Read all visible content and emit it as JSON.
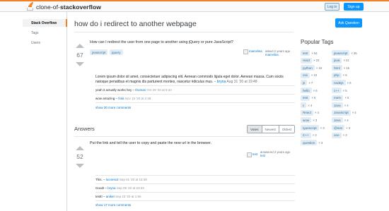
{
  "header": {
    "logo_prefix": "clone-of-",
    "logo_bold": "stackoverflow",
    "login_label": "Log in",
    "signup_label": "Sign up"
  },
  "sidebar": {
    "items": [
      {
        "label": "Stack Overflow",
        "active": true
      },
      {
        "label": "Tags",
        "active": false
      },
      {
        "label": "Users",
        "active": false
      }
    ]
  },
  "question": {
    "title": "how do i redirect to another webpage",
    "ask_label": "Ask Question",
    "votes": "67",
    "body": "How can I redirect the user from one page to another using jQuery or pure JavaScript?",
    "tags": [
      "javascript",
      "jquery"
    ],
    "avatar_alt": "marcelina",
    "asked": "asked 2 years ago",
    "author": "marcelina",
    "answer_text_line1": "Lorem ipsum dolor sit amet, consectetuer adipiscing elit. Aenean commodo ligula eget dolor. Aenean massa. Cum sociis",
    "answer_text_line2": "natoque penatibus et magnis dis parturient montes, nascetur ridiculus mus.",
    "answer_text_user": "bryna",
    "answer_text_date": "Aug 31 '20 at 19:48",
    "comments": [
      {
        "text": "yeah it actually works hey",
        "user": "thomas",
        "date": "Oct 29 '20 at 5:33"
      },
      {
        "text": "wow amazing",
        "user": "fiola",
        "date": "Nov 16 '20 at 2:48"
      }
    ],
    "show_more": "show 30 more comments"
  },
  "answers": {
    "heading": "Answers",
    "sort_options": [
      "Votes",
      "Newest",
      "Oldest"
    ],
    "items": [
      {
        "votes": "52",
        "body": "Put the link and tell the user to copy and paste the new url in the browser.",
        "avatar_alt": "test",
        "answered": "answered 2 years ago",
        "author": "test",
        "comments": [
          {
            "text": "This.",
            "user": "locness3",
            "date": "Sep 01 '20 at 15:39"
          },
          {
            "text": "Good!",
            "user": "bryna",
            "date": "Sep 05 '20 at 23:33"
          },
          {
            "text": "testt!",
            "user": "aniket",
            "date": "Sep 23 '20 at 1:56"
          }
        ],
        "show_more": "show 17 more comments"
      }
    ]
  },
  "popular_tags": {
    "title": "Popular Tags",
    "left": [
      {
        "name": "test",
        "count": "54"
      },
      {
        "name": "react",
        "count": "23"
      },
      {
        "name": "python",
        "count": "19"
      },
      {
        "name": "css",
        "count": "10"
      },
      {
        "name": "js",
        "count": "7"
      },
      {
        "name": "hello",
        "count": "6"
      },
      {
        "name": "test",
        "count": "5"
      },
      {
        "name": "c",
        "count": "4"
      },
      {
        "name": "React",
        "count": "4"
      },
      {
        "name": "wow",
        "count": "3"
      },
      {
        "name": "typescript",
        "count": "3"
      },
      {
        "name": "C++",
        "count": "3"
      },
      {
        "name": "question",
        "count": "3"
      }
    ],
    "right": [
      {
        "name": "javascript",
        "count": "35"
      },
      {
        "name": "java",
        "count": "21"
      },
      {
        "name": "html",
        "count": "15"
      },
      {
        "name": "php",
        "count": "8"
      },
      {
        "name": "nodejs",
        "count": "6"
      },
      {
        "name": "c++",
        "count": "5"
      },
      {
        "name": "mern",
        "count": "5"
      },
      {
        "name": "Java",
        "count": "4"
      },
      {
        "name": "Javascript",
        "count": "4"
      },
      {
        "name": "Java",
        "count": "4"
      },
      {
        "name": "@test",
        "count": "3"
      },
      {
        "name": "one",
        "count": "3"
      }
    ]
  },
  "colors": {
    "accent": "#f48024",
    "primary_button": "#0a95ff",
    "tag_bg": "#e1ecf4",
    "tag_text": "#39739d",
    "link": "#0074cc"
  }
}
